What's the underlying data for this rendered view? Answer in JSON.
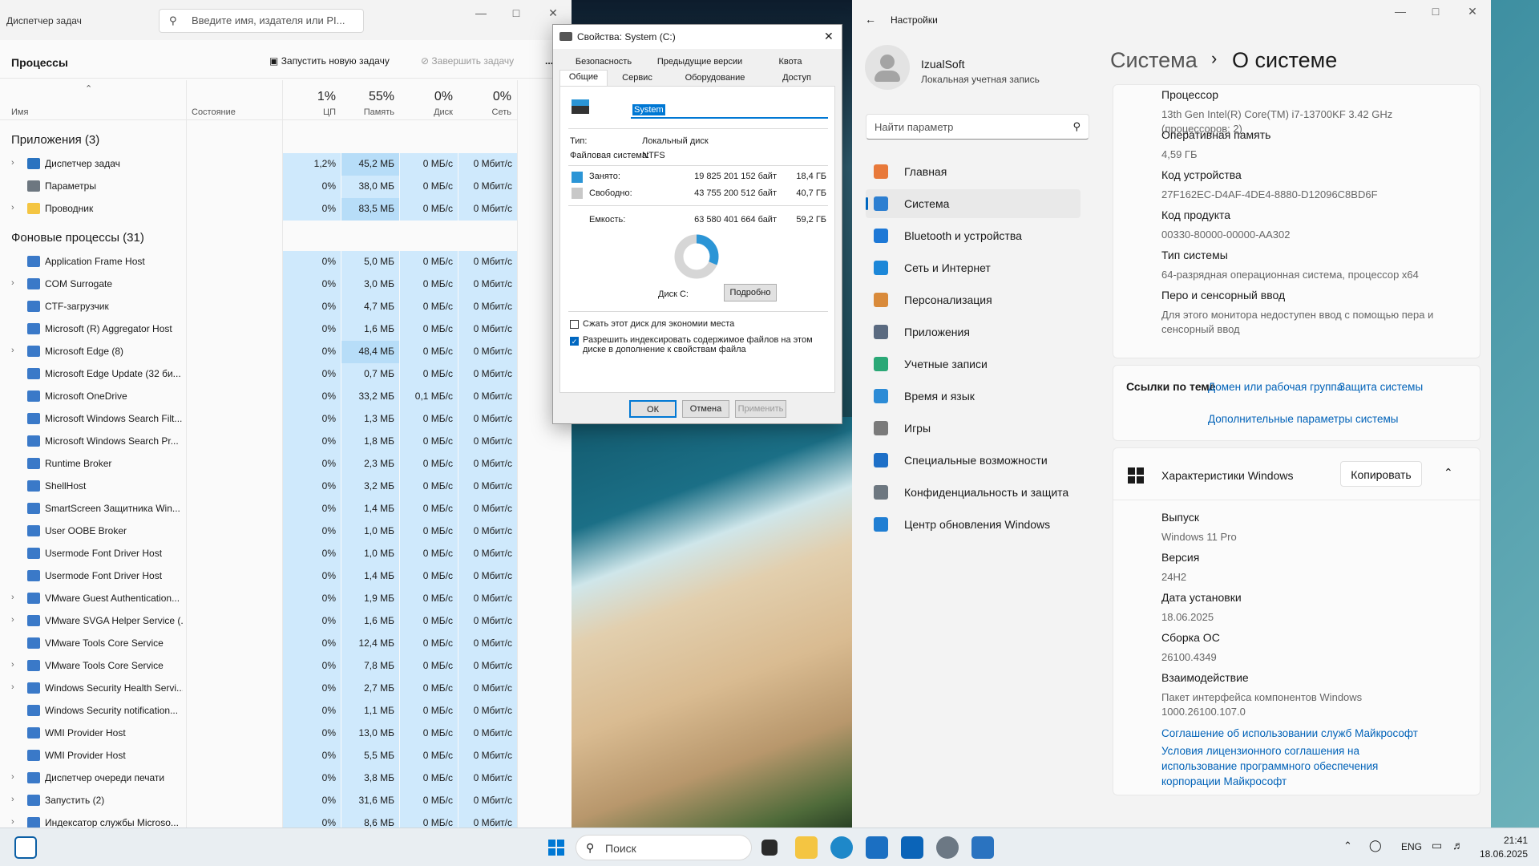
{
  "taskmgr": {
    "title": "Диспетчер задач",
    "search_placeholder": "Введите имя, издателя или PI...",
    "section": "Процессы",
    "run_new": "Запустить новую задачу",
    "end_task": "Завершить задачу",
    "more": "...",
    "col_name": "Имя",
    "col_status": "Состояние",
    "cpu_pct": "1%",
    "cpu": "ЦП",
    "mem_pct": "55%",
    "mem": "Память",
    "disk_pct": "0%",
    "disk": "Диск",
    "net_pct": "0%",
    "net": "Сеть",
    "apps_header": "Приложения (3)",
    "bg_header": "Фоновые процессы (31)",
    "apps": [
      {
        "name": "Диспетчер задач",
        "cpu": "1,2%",
        "mem": "45,2 МБ",
        "disk": "0 МБ/с",
        "net": "0 Мбит/с",
        "exp": "›"
      },
      {
        "name": "Параметры",
        "cpu": "0%",
        "mem": "38,0 МБ",
        "disk": "0 МБ/с",
        "net": "0 Мбит/с",
        "exp": ""
      },
      {
        "name": "Проводник",
        "cpu": "0%",
        "mem": "83,5 МБ",
        "disk": "0 МБ/с",
        "net": "0 Мбит/с",
        "exp": "›"
      }
    ],
    "bg": [
      {
        "name": "Application Frame Host",
        "cpu": "0%",
        "mem": "5,0 МБ",
        "disk": "0 МБ/с",
        "net": "0 Мбит/с",
        "exp": ""
      },
      {
        "name": "COM Surrogate",
        "cpu": "0%",
        "mem": "3,0 МБ",
        "disk": "0 МБ/с",
        "net": "0 Мбит/с",
        "exp": "›"
      },
      {
        "name": "CTF-загрузчик",
        "cpu": "0%",
        "mem": "4,7 МБ",
        "disk": "0 МБ/с",
        "net": "0 Мбит/с",
        "exp": ""
      },
      {
        "name": "Microsoft (R) Aggregator Host",
        "cpu": "0%",
        "mem": "1,6 МБ",
        "disk": "0 МБ/с",
        "net": "0 Мбит/с",
        "exp": ""
      },
      {
        "name": "Microsoft Edge (8)",
        "cpu": "0%",
        "mem": "48,4 МБ",
        "disk": "0 МБ/с",
        "net": "0 Мбит/с",
        "exp": "›"
      },
      {
        "name": "Microsoft Edge Update (32 би...",
        "cpu": "0%",
        "mem": "0,7 МБ",
        "disk": "0 МБ/с",
        "net": "0 Мбит/с",
        "exp": ""
      },
      {
        "name": "Microsoft OneDrive",
        "cpu": "0%",
        "mem": "33,2 МБ",
        "disk": "0,1 МБ/с",
        "net": "0 Мбит/с",
        "exp": ""
      },
      {
        "name": "Microsoft Windows Search Filt...",
        "cpu": "0%",
        "mem": "1,3 МБ",
        "disk": "0 МБ/с",
        "net": "0 Мбит/с",
        "exp": ""
      },
      {
        "name": "Microsoft Windows Search Pr...",
        "cpu": "0%",
        "mem": "1,8 МБ",
        "disk": "0 МБ/с",
        "net": "0 Мбит/с",
        "exp": ""
      },
      {
        "name": "Runtime Broker",
        "cpu": "0%",
        "mem": "2,3 МБ",
        "disk": "0 МБ/с",
        "net": "0 Мбит/с",
        "exp": ""
      },
      {
        "name": "ShellHost",
        "cpu": "0%",
        "mem": "3,2 МБ",
        "disk": "0 МБ/с",
        "net": "0 Мбит/с",
        "exp": ""
      },
      {
        "name": "SmartScreen Защитника Win...",
        "cpu": "0%",
        "mem": "1,4 МБ",
        "disk": "0 МБ/с",
        "net": "0 Мбит/с",
        "exp": ""
      },
      {
        "name": "User OOBE Broker",
        "cpu": "0%",
        "mem": "1,0 МБ",
        "disk": "0 МБ/с",
        "net": "0 Мбит/с",
        "exp": ""
      },
      {
        "name": "Usermode Font Driver Host",
        "cpu": "0%",
        "mem": "1,0 МБ",
        "disk": "0 МБ/с",
        "net": "0 Мбит/с",
        "exp": ""
      },
      {
        "name": "Usermode Font Driver Host",
        "cpu": "0%",
        "mem": "1,4 МБ",
        "disk": "0 МБ/с",
        "net": "0 Мбит/с",
        "exp": ""
      },
      {
        "name": "VMware Guest Authentication...",
        "cpu": "0%",
        "mem": "1,9 МБ",
        "disk": "0 МБ/с",
        "net": "0 Мбит/с",
        "exp": "›"
      },
      {
        "name": "VMware SVGA Helper Service (...",
        "cpu": "0%",
        "mem": "1,6 МБ",
        "disk": "0 МБ/с",
        "net": "0 Мбит/с",
        "exp": "›"
      },
      {
        "name": "VMware Tools Core Service",
        "cpu": "0%",
        "mem": "12,4 МБ",
        "disk": "0 МБ/с",
        "net": "0 Мбит/с",
        "exp": ""
      },
      {
        "name": "VMware Tools Core Service",
        "cpu": "0%",
        "mem": "7,8 МБ",
        "disk": "0 МБ/с",
        "net": "0 Мбит/с",
        "exp": "›"
      },
      {
        "name": "Windows Security Health Servi...",
        "cpu": "0%",
        "mem": "2,7 МБ",
        "disk": "0 МБ/с",
        "net": "0 Мбит/с",
        "exp": "›"
      },
      {
        "name": "Windows Security notification...",
        "cpu": "0%",
        "mem": "1,1 МБ",
        "disk": "0 МБ/с",
        "net": "0 Мбит/с",
        "exp": ""
      },
      {
        "name": "WMI Provider Host",
        "cpu": "0%",
        "mem": "13,0 МБ",
        "disk": "0 МБ/с",
        "net": "0 Мбит/с",
        "exp": ""
      },
      {
        "name": "WMI Provider Host",
        "cpu": "0%",
        "mem": "5,5 МБ",
        "disk": "0 МБ/с",
        "net": "0 Мбит/с",
        "exp": ""
      },
      {
        "name": "Диспетчер очереди печати",
        "cpu": "0%",
        "mem": "3,8 МБ",
        "disk": "0 МБ/с",
        "net": "0 Мбит/с",
        "exp": "›"
      },
      {
        "name": "Запустить (2)",
        "cpu": "0%",
        "mem": "31,6 МБ",
        "disk": "0 МБ/с",
        "net": "0 Мбит/с",
        "exp": "›"
      },
      {
        "name": "Индексатор службы Microso...",
        "cpu": "0%",
        "mem": "8,6 МБ",
        "disk": "0 МБ/с",
        "net": "0 Мбит/с",
        "exp": "›"
      }
    ]
  },
  "props": {
    "title": "Свойства: System (C:)",
    "tabs_top": [
      "Безопасность",
      "Предыдущие версии",
      "Квота"
    ],
    "tabs_bottom": [
      "Общие",
      "Сервис",
      "Оборудование",
      "Доступ"
    ],
    "label": "System",
    "type_k": "Тип:",
    "type_v": "Локальный диск",
    "fs_k": "Файловая система:",
    "fs_v": "NTFS",
    "used_k": "Занято:",
    "used_b": "19 825 201 152 байт",
    "used_g": "18,4 ГБ",
    "free_k": "Свободно:",
    "free_b": "43 755 200 512 байт",
    "free_g": "40,7 ГБ",
    "cap_k": "Емкость:",
    "cap_b": "63 580 401 664 байт",
    "cap_g": "59,2 ГБ",
    "disk_label": "Диск C:",
    "details": "Подробно",
    "compress": "Сжать этот диск для экономии места",
    "index": "Разрешить индексировать содержимое файлов на этом диске в дополнение к свойствам файла",
    "ok": "ОК",
    "cancel": "Отмена",
    "apply": "Применить",
    "used_color": "#2b95d6",
    "free_color": "#d6d6d6"
  },
  "settings": {
    "title": "Настройки",
    "user": "IzualSoft",
    "account": "Локальная учетная запись",
    "search_placeholder": "Найти параметр",
    "breadcrumb_parent": "Система",
    "breadcrumb_sep": "›",
    "breadcrumb_current": "О системе",
    "nav": [
      {
        "label": "Главная",
        "color": "#e8793a"
      },
      {
        "label": "Система",
        "color": "#2d7fd1"
      },
      {
        "label": "Bluetooth и устройства",
        "color": "#1d78d6"
      },
      {
        "label": "Сеть и Интернет",
        "color": "#1c87d8"
      },
      {
        "label": "Персонализация",
        "color": "#d98a3a"
      },
      {
        "label": "Приложения",
        "color": "#5a6a80"
      },
      {
        "label": "Учетные записи",
        "color": "#2aa876"
      },
      {
        "label": "Время и язык",
        "color": "#2c8bd6"
      },
      {
        "label": "Игры",
        "color": "#7a7a7a"
      },
      {
        "label": "Специальные возможности",
        "color": "#1d6fc7"
      },
      {
        "label": "Конфиденциальность и защита",
        "color": "#6d7780"
      },
      {
        "label": "Центр обновления Windows",
        "color": "#1f7ed3"
      }
    ],
    "device": [
      {
        "k": "Процессор",
        "v": "13th Gen Intel(R) Core(TM) i7-13700KF   3.42 GHz (процессоров: 2)"
      },
      {
        "k": "Оперативная память",
        "v": "4,59 ГБ"
      },
      {
        "k": "Код устройства",
        "v": "27F162EC-D4AF-4DE4-8880-D12096C8BD6F"
      },
      {
        "k": "Код продукта",
        "v": "00330-80000-00000-AA302"
      },
      {
        "k": "Тип системы",
        "v": "64-разрядная операционная система, процессор x64"
      },
      {
        "k": "Перо и сенсорный ввод",
        "v": "Для этого монитора недоступен ввод с помощью пера и сенсорный ввод"
      }
    ],
    "related": "Ссылки по теме",
    "link_domain": "Домен или рабочая группа",
    "link_protect": "Защита системы",
    "link_advanced": "Дополнительные параметры системы",
    "win_spec": "Характеристики Windows",
    "copy": "Копировать",
    "spec": [
      {
        "k": "Выпуск",
        "v": "Windows 11 Pro"
      },
      {
        "k": "Версия",
        "v": "24H2"
      },
      {
        "k": "Дата установки",
        "v": "18.06.2025"
      },
      {
        "k": "Сборка ОС",
        "v": "26100.4349"
      },
      {
        "k": "Взаимодействие",
        "v": "Пакет интерфейса компонентов Windows 1000.26100.107.0"
      }
    ],
    "link_services": "Соглашение об использовании служб Майкрософт",
    "link_license": "Условия лицензионного соглашения на использование программного обеспечения корпорации Майкрософт"
  },
  "taskbar": {
    "search": "Поиск",
    "lang": "ENG",
    "time": "21:41",
    "date": "18.06.2025"
  }
}
